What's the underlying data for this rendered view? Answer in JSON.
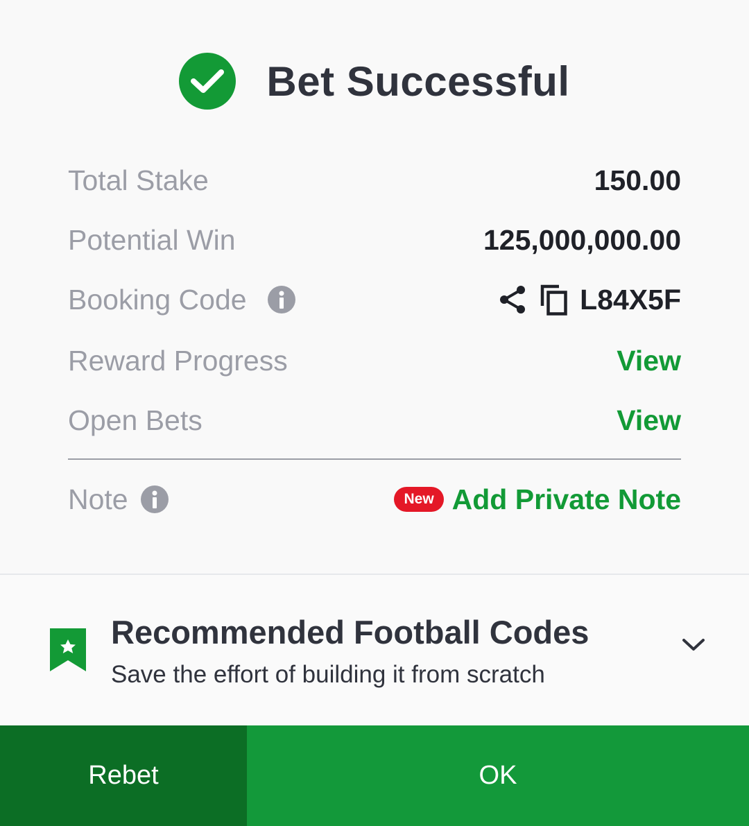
{
  "header": {
    "title": "Bet Successful",
    "icon": "check-circle-icon"
  },
  "summary": {
    "total_stake_label": "Total Stake",
    "total_stake_value": "150.00",
    "potential_win_label": "Potential Win",
    "potential_win_value": "125,000,000.00",
    "booking_code_label": "Booking Code",
    "booking_code_value": "L84X5F",
    "reward_progress_label": "Reward Progress",
    "reward_progress_link": "View",
    "open_bets_label": "Open Bets",
    "open_bets_link": "View",
    "note_label": "Note",
    "new_badge": "New",
    "add_note_link": "Add Private Note"
  },
  "recommended": {
    "title": "Recommended Football Codes",
    "subtitle": "Save the effort of building it from scratch"
  },
  "actions": {
    "rebet_label": "Rebet",
    "ok_label": "OK"
  },
  "colors": {
    "brand_green": "#139a36",
    "dark_green": "#0c6e25",
    "badge_red": "#e41827",
    "label_gray": "#9b9da6",
    "text_dark": "#30333d"
  }
}
